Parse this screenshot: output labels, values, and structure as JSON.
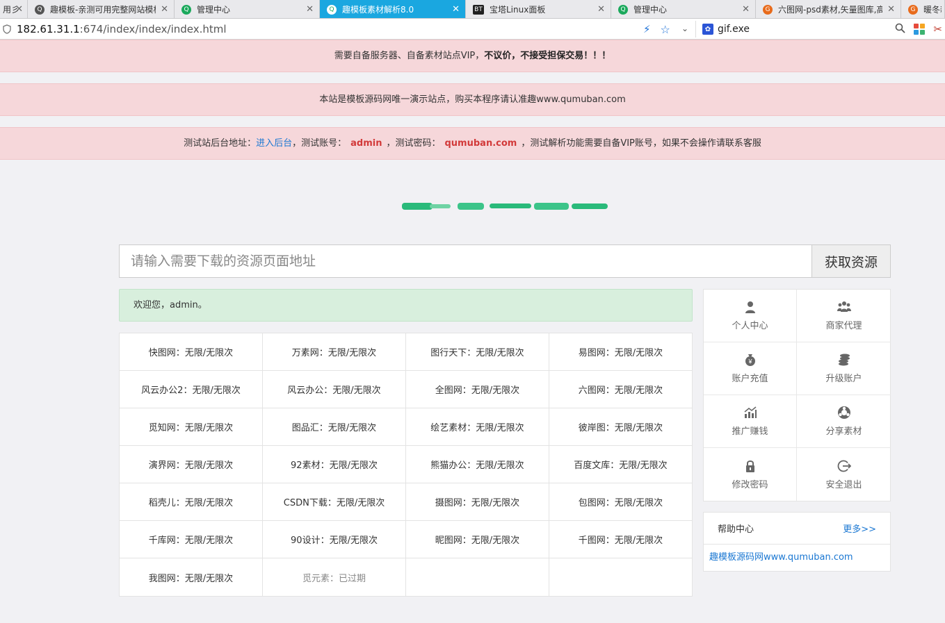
{
  "browser": {
    "tabs": [
      {
        "title": "用彡",
        "icon": "none",
        "active": false,
        "close": false
      },
      {
        "title": "趣模板-亲测可用完整网站模板",
        "icon": "q-logo-icon",
        "active": false,
        "close": true
      },
      {
        "title": "管理中心",
        "icon": "green-q-icon",
        "active": false,
        "close": true
      },
      {
        "title": "趣模板素材解析8.0",
        "icon": "green-q-icon",
        "active": true,
        "close": true
      },
      {
        "title": "宝塔Linux面板",
        "icon": "bt-icon",
        "active": false,
        "close": true
      },
      {
        "title": "管理中心",
        "icon": "green-q-icon",
        "active": false,
        "close": true
      },
      {
        "title": "六图网-psd素材,矢量图库,高",
        "icon": "orange-icon",
        "active": false,
        "close": true
      },
      {
        "title": "暖冬新",
        "icon": "orange-icon",
        "active": false,
        "close": false
      }
    ],
    "address": {
      "host": "182.61.31.1",
      "path": ":674/index/index/index.html"
    },
    "search_engine_text": "gif.exe"
  },
  "notices": {
    "n1_text": "需要自备服务器、自备素材站点VIP，",
    "n1_bold": "不议价，不接受担保交易！！！",
    "n2_text": "本站是模板源码网唯一演示站点，购买本程序请认准趣www.qumuban.com",
    "n3_a": "测试站后台地址：",
    "n3_link": "进入后台",
    "n3_b": "，测试账号：",
    "n3_account": "admin",
    "n3_c": "，测试密码：",
    "n3_password": "qumuban.com",
    "n3_d": "，测试解析功能需要自备VIP账号，如果不会操作请联系客服"
  },
  "search": {
    "placeholder": "请输入需要下载的资源页面地址",
    "button": "获取资源"
  },
  "welcome": "欢迎您，admin。",
  "quota": [
    "快图网：无限/无限次",
    "万素网：无限/无限次",
    "图行天下：无限/无限次",
    "易图网：无限/无限次",
    "风云办公2：无限/无限次",
    "风云办公：无限/无限次",
    "全图网：无限/无限次",
    "六图网：无限/无限次",
    "觅知网：无限/无限次",
    "图品汇：无限/无限次",
    "绘艺素材：无限/无限次",
    "彼岸图：无限/无限次",
    "演界网：无限/无限次",
    "92素材：无限/无限次",
    "熊猫办公：无限/无限次",
    "百度文库：无限/无限次",
    "稻壳儿：无限/无限次",
    "CSDN下载：无限/无限次",
    "摄图网：无限/无限次",
    "包图网：无限/无限次",
    "千库网：无限/无限次",
    "90设计：无限/无限次",
    "昵图网：无限/无限次",
    "千图网：无限/无限次",
    "我图网：无限/无限次",
    "觅元素：已过期",
    "",
    ""
  ],
  "menu": [
    {
      "label": "个人中心",
      "icon": "user-icon"
    },
    {
      "label": "商家代理",
      "icon": "users-icon"
    },
    {
      "label": "账户充值",
      "icon": "money-bag-icon"
    },
    {
      "label": "升级账户",
      "icon": "coins-icon"
    },
    {
      "label": "推广赚钱",
      "icon": "chart-icon"
    },
    {
      "label": "分享素材",
      "icon": "share-icon"
    },
    {
      "label": "修改密码",
      "icon": "lock-icon"
    },
    {
      "label": "安全退出",
      "icon": "logout-icon"
    }
  ],
  "help": {
    "title": "帮助中心",
    "more": "更多>>",
    "items": [
      "趣模板源码网www.qumuban.com"
    ]
  },
  "colors": {
    "accent": "#1aa7e0",
    "notice_bg": "#f6d7da",
    "welcome_bg": "#d8efdd",
    "link": "#1a77d2",
    "red": "#d23a3a"
  }
}
